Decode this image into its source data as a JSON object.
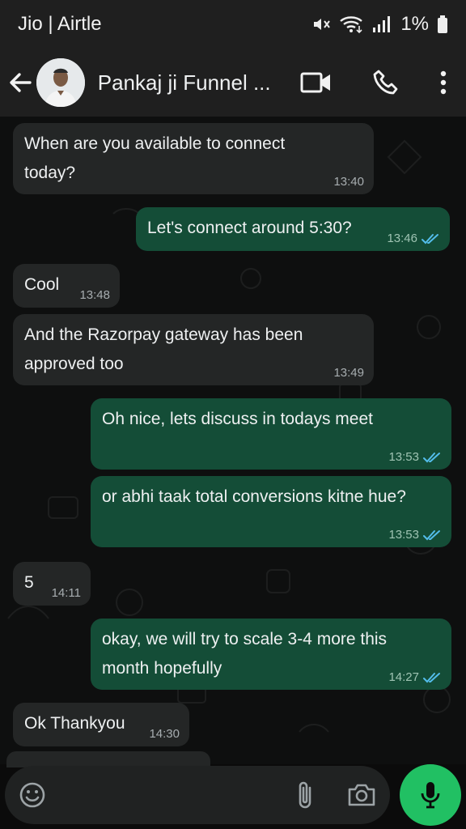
{
  "status_bar": {
    "carrier": "Jio | Airtle",
    "battery": "1%"
  },
  "header": {
    "contact_name": "Pankaj ji Funnel ..."
  },
  "messages": [
    {
      "direction": "in",
      "lines": [
        "When are you available to connect",
        "today?"
      ],
      "time": "13:40"
    },
    {
      "direction": "out",
      "lines": [
        "Let's connect around 5:30?"
      ],
      "time": "13:46",
      "read": true
    },
    {
      "direction": "in",
      "lines": [
        "Cool"
      ],
      "time": "13:48"
    },
    {
      "direction": "in",
      "lines": [
        "And the Razorpay gateway has been",
        "approved too"
      ],
      "time": "13:49"
    },
    {
      "direction": "out",
      "lines": [
        "Oh nice, lets discuss in todays meet"
      ],
      "time": "13:53",
      "read": true
    },
    {
      "direction": "out",
      "lines": [
        "or abhi taak total conversions kitne hue?"
      ],
      "time": "13:53",
      "read": true
    },
    {
      "direction": "in",
      "lines": [
        "5"
      ],
      "time": "14:11"
    },
    {
      "direction": "out",
      "lines": [
        "okay, we will try to scale 3-4 more this",
        "month hopefully"
      ],
      "time": "14:27",
      "read": true
    },
    {
      "direction": "in",
      "lines": [
        "Ok Thankyou"
      ],
      "time": "14:30"
    }
  ],
  "colors": {
    "bg": "#0e0f0f",
    "incoming_bubble": "#242626",
    "outgoing_bubble": "#144d37",
    "read_tick": "#53bdeb",
    "mic_button": "#21c063"
  },
  "icons": {
    "back": "arrow-left-icon",
    "video": "video-call-icon",
    "call": "phone-icon",
    "more": "more-vertical-icon",
    "emoji": "emoji-icon",
    "attach": "paperclip-icon",
    "camera": "camera-icon",
    "mic": "microphone-icon"
  }
}
